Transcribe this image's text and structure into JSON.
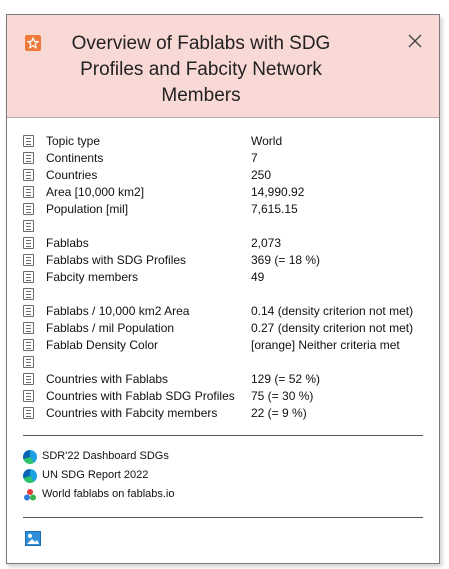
{
  "header": {
    "title": "Overview of Fablabs with SDG Profiles and Fabcity Network Members",
    "title_lines": [
      "Overview of Fablabs with SDG",
      "Profiles and Fabcity Network",
      "Members"
    ],
    "icon": "star-icon",
    "close_icon": "close-icon",
    "color": "#f9d9d6"
  },
  "rows": [
    {
      "label": "Topic type",
      "value": "World"
    },
    {
      "label": "Continents",
      "value": "7"
    },
    {
      "label": "Countries",
      "value": "250"
    },
    {
      "label": "Area [10,000 km2]",
      "value": "14,990.92"
    },
    {
      "label": "Population [mil]",
      "value": "7,615.15"
    },
    {
      "label": "",
      "value": ""
    },
    {
      "label": "Fablabs",
      "value": "2,073"
    },
    {
      "label": "Fablabs with SDG Profiles",
      "value": "369  (= 18 %)"
    },
    {
      "label": "Fabcity members",
      "value": "49"
    },
    {
      "label": "",
      "value": ""
    },
    {
      "label": "Fablabs / 10,000 km2 Area",
      "value": "0.14 (density criterion not met)"
    },
    {
      "label": "Fablabs / mil Population",
      "value": "0.27 (density criterion not met)"
    },
    {
      "label": "Fablab Density Color",
      "value": "[orange] Neither criteria met"
    },
    {
      "label": "",
      "value": ""
    },
    {
      "label": "Countries with Fablabs",
      "value": "129  (= 52 %)"
    },
    {
      "label": "Countries with Fablab SDG Profiles",
      "value": "75  (= 30 %)"
    },
    {
      "label": "Countries with Fabcity members",
      "value": "22  (= 9 %)"
    }
  ],
  "links": [
    {
      "label": "SDR'22 Dashboard SDGs",
      "icon": "edge-icon"
    },
    {
      "label": "UN SDG Report 2022",
      "icon": "edge-icon"
    },
    {
      "label": "World fablabs on fablabs.io",
      "icon": "fablabs-icon"
    }
  ],
  "footer": {
    "icon": "image-icon"
  }
}
